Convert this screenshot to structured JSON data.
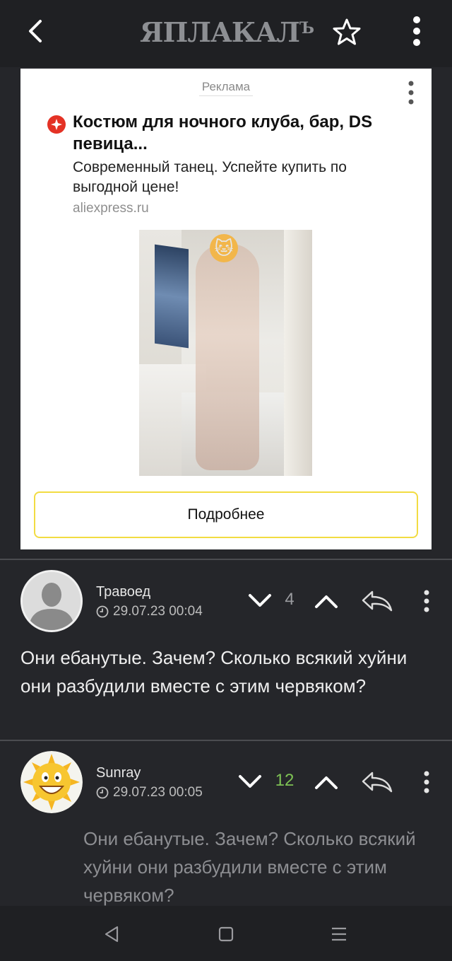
{
  "app": {
    "title": "ЯПЛАКАЛ",
    "title_suffix": "Ъ"
  },
  "ad": {
    "label": "Реклама",
    "title": "Костюм для ночного клуба, бар, DS певица...",
    "description": "Современный танец. Успейте купить по выгодной цене!",
    "domain": "aliexpress.ru",
    "button_label": "Подробнее"
  },
  "comments": [
    {
      "author": "Травоед",
      "date": "29.07.23 00:04",
      "votes": "4",
      "votes_color": "#9a9b9f",
      "text": "Они ебанутые. Зачем? Сколько всякий хуйни они разбудили вместе с этим червяком?"
    },
    {
      "author": "Sunray",
      "date": "29.07.23 00:05",
      "votes": "12",
      "votes_color": "#7ec254",
      "quote": "Они ебанутые. Зачем? Сколько всякий хуйни они разбудили вместе с этим червяком?"
    }
  ],
  "icons": {
    "back": "chevron-left-icon",
    "favorite": "star-icon",
    "menu": "kebab-menu-icon",
    "vote_down": "chevron-down-icon",
    "vote_up": "chevron-up-icon",
    "reply": "reply-arrow-icon",
    "clock": "clock-icon",
    "nav_back": "triangle-back-icon",
    "nav_home": "square-home-icon",
    "nav_recent": "lines-recent-icon"
  },
  "colors": {
    "background": "#25262a",
    "appbar": "#1f2023",
    "ad_button_border": "#f2dc42",
    "positive_votes": "#7ec254"
  }
}
